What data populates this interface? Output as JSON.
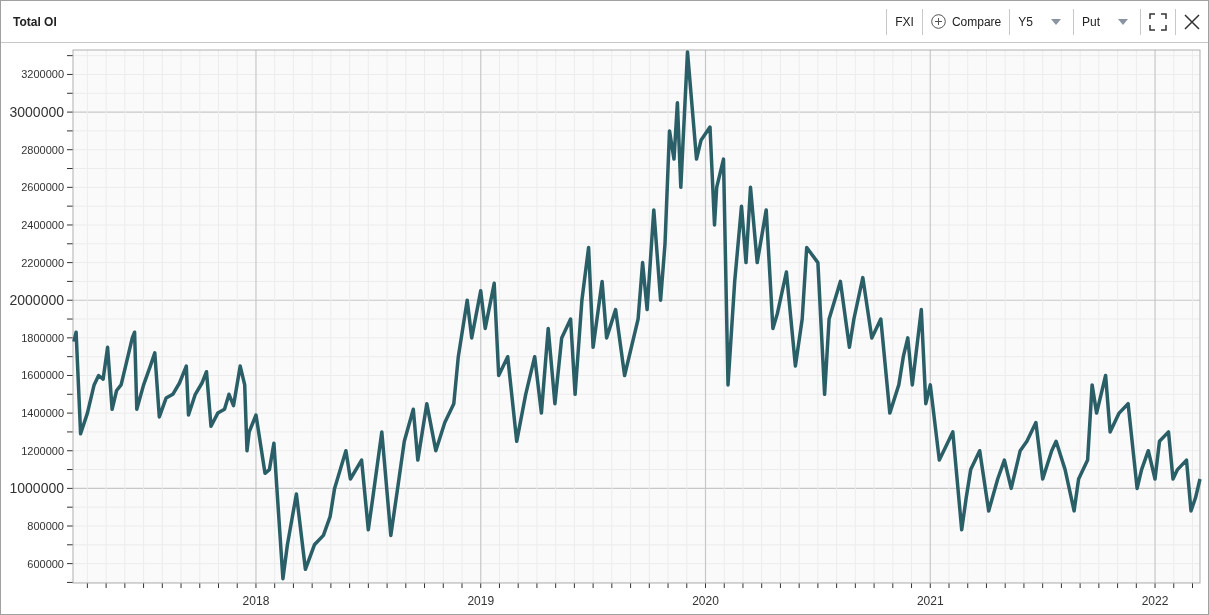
{
  "header": {
    "title": "Total OI",
    "controls": [
      {
        "kind": "text",
        "label": "FXI"
      },
      {
        "kind": "compare",
        "label": "Compare"
      },
      {
        "kind": "dropdown",
        "label": "Y5"
      },
      {
        "kind": "dropdown",
        "label": "Put"
      }
    ]
  },
  "chart": {
    "chart_data": {
      "type": "line",
      "grid": true,
      "xlim": [
        2017.186,
        2022.2
      ],
      "ylim": [
        497000,
        3330000
      ],
      "xticks": [
        {
          "value": 2018,
          "label": "2018"
        },
        {
          "value": 2019,
          "label": "2019"
        },
        {
          "value": 2020,
          "label": "2020"
        },
        {
          "value": 2021,
          "label": "2021"
        },
        {
          "value": 2022,
          "label": "2022"
        }
      ],
      "yticks": [
        600000,
        800000,
        1000000,
        1200000,
        1400000,
        1600000,
        1800000,
        2000000,
        2200000,
        2400000,
        2600000,
        2800000,
        3000000,
        3200000
      ],
      "x": [
        2017.19,
        2017.2,
        2017.22,
        2017.25,
        2017.28,
        2017.3,
        2017.32,
        2017.34,
        2017.36,
        2017.38,
        2017.4,
        2017.42,
        2017.45,
        2017.46,
        2017.47,
        2017.5,
        2017.53,
        2017.55,
        2017.57,
        2017.6,
        2017.63,
        2017.66,
        2017.69,
        2017.7,
        2017.73,
        2017.76,
        2017.78,
        2017.8,
        2017.83,
        2017.86,
        2017.88,
        2017.9,
        2017.93,
        2017.95,
        2017.96,
        2017.97,
        2018.0,
        2018.04,
        2018.06,
        2018.08,
        2018.12,
        2018.14,
        2018.18,
        2018.22,
        2018.26,
        2018.3,
        2018.33,
        2018.35,
        2018.4,
        2018.42,
        2018.47,
        2018.5,
        2018.52,
        2018.56,
        2018.6,
        2018.63,
        2018.66,
        2018.7,
        2018.72,
        2018.76,
        2018.8,
        2018.84,
        2018.88,
        2018.9,
        2018.94,
        2018.96,
        2019.0,
        2019.02,
        2019.06,
        2019.08,
        2019.12,
        2019.16,
        2019.2,
        2019.24,
        2019.27,
        2019.3,
        2019.33,
        2019.36,
        2019.4,
        2019.42,
        2019.45,
        2019.48,
        2019.5,
        2019.54,
        2019.56,
        2019.6,
        2019.64,
        2019.68,
        2019.7,
        2019.72,
        2019.74,
        2019.77,
        2019.8,
        2019.82,
        2019.84,
        2019.86,
        2019.875,
        2019.89,
        2019.92,
        2019.96,
        2019.98,
        2020.02,
        2020.04,
        2020.05,
        2020.08,
        2020.1,
        2020.13,
        2020.16,
        2020.18,
        2020.2,
        2020.23,
        2020.27,
        2020.3,
        2020.32,
        2020.36,
        2020.4,
        2020.43,
        2020.45,
        2020.5,
        2020.53,
        2020.55,
        2020.6,
        2020.64,
        2020.66,
        2020.7,
        2020.74,
        2020.78,
        2020.82,
        2020.86,
        2020.88,
        2020.9,
        2020.92,
        2020.96,
        2020.98,
        2021.0,
        2021.04,
        2021.06,
        2021.1,
        2021.14,
        2021.16,
        2021.18,
        2021.22,
        2021.26,
        2021.3,
        2021.33,
        2021.36,
        2021.4,
        2021.43,
        2021.47,
        2021.5,
        2021.54,
        2021.56,
        2021.6,
        2021.64,
        2021.66,
        2021.7,
        2021.72,
        2021.74,
        2021.78,
        2021.8,
        2021.84,
        2021.88,
        2021.92,
        2021.94,
        2021.97,
        2022.0,
        2022.02,
        2022.06,
        2022.08,
        2022.1,
        2022.14,
        2022.16,
        2022.18,
        2022.2
      ],
      "series": [
        {
          "color": "#2b5f68",
          "values": [
            1780000,
            1830000,
            1290000,
            1400000,
            1550000,
            1600000,
            1580000,
            1750000,
            1420000,
            1520000,
            1550000,
            1650000,
            1800000,
            1830000,
            1420000,
            1550000,
            1650000,
            1720000,
            1380000,
            1480000,
            1500000,
            1560000,
            1650000,
            1390000,
            1500000,
            1560000,
            1620000,
            1330000,
            1400000,
            1420000,
            1500000,
            1440000,
            1650000,
            1550000,
            1200000,
            1300000,
            1390000,
            1080000,
            1100000,
            1240000,
            520000,
            700000,
            970000,
            570000,
            700000,
            750000,
            850000,
            1000000,
            1200000,
            1050000,
            1150000,
            780000,
            950000,
            1300000,
            750000,
            1000000,
            1250000,
            1420000,
            1150000,
            1450000,
            1200000,
            1350000,
            1450000,
            1700000,
            2000000,
            1800000,
            2050000,
            1850000,
            2090000,
            1600000,
            1700000,
            1250000,
            1500000,
            1700000,
            1400000,
            1850000,
            1450000,
            1800000,
            1900000,
            1500000,
            2000000,
            2280000,
            1750000,
            2100000,
            1800000,
            1950000,
            1600000,
            1800000,
            1900000,
            2200000,
            1950000,
            2480000,
            2000000,
            2300000,
            2900000,
            2750000,
            3050000,
            2600000,
            3320000,
            2750000,
            2850000,
            2920000,
            2400000,
            2600000,
            2750000,
            1550000,
            2100000,
            2500000,
            2200000,
            2600000,
            2200000,
            2480000,
            1850000,
            1930000,
            2150000,
            1650000,
            1900000,
            2280000,
            2200000,
            1500000,
            1900000,
            2100000,
            1750000,
            1900000,
            2120000,
            1800000,
            1900000,
            1400000,
            1550000,
            1700000,
            1800000,
            1550000,
            1950000,
            1450000,
            1550000,
            1150000,
            1200000,
            1300000,
            780000,
            950000,
            1100000,
            1200000,
            880000,
            1050000,
            1150000,
            1000000,
            1200000,
            1250000,
            1350000,
            1050000,
            1200000,
            1250000,
            1100000,
            880000,
            1050000,
            1150000,
            1550000,
            1400000,
            1600000,
            1300000,
            1400000,
            1450000,
            1000000,
            1100000,
            1200000,
            1050000,
            1250000,
            1300000,
            1050000,
            1100000,
            1150000,
            880000,
            950000,
            1050000
          ]
        }
      ]
    }
  }
}
